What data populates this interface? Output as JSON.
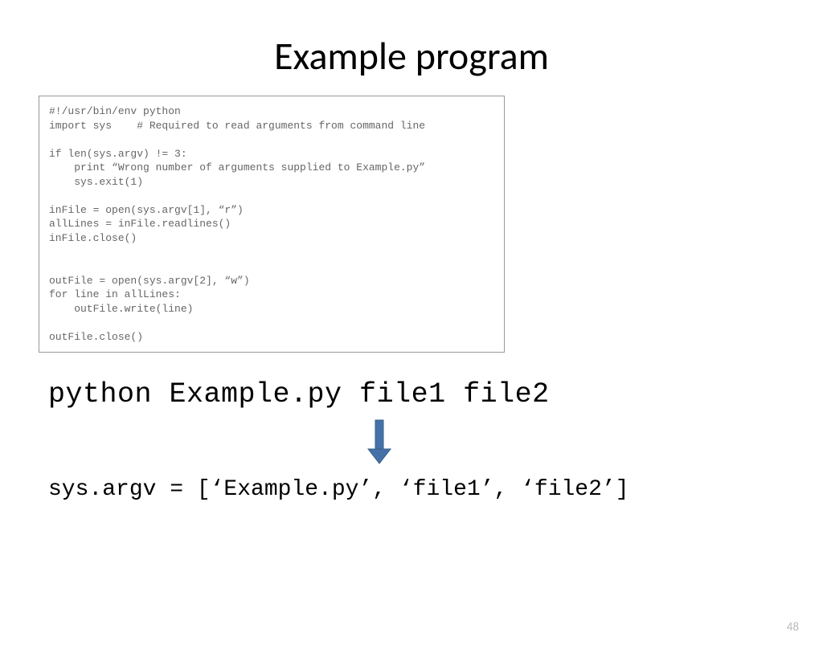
{
  "title": "Example program",
  "code": "#!/usr/bin/env python\nimport sys    # Required to read arguments from command line\n\nif len(sys.argv) != 3:\n    print “Wrong number of arguments supplied to Example.py”\n    sys.exit(1)\n\ninFile = open(sys.argv[1], “r”)\nallLines = inFile.readlines()\ninFile.close()\n\n\noutFile = open(sys.argv[2], “w”)\nfor line in allLines:\n    outFile.write(line)\n\noutFile.close()",
  "command_line": "python Example.py file1 file2",
  "argv_line": "sys.argv = [‘Example.py’, ‘file1’, ‘file2’]",
  "page_number": "48"
}
